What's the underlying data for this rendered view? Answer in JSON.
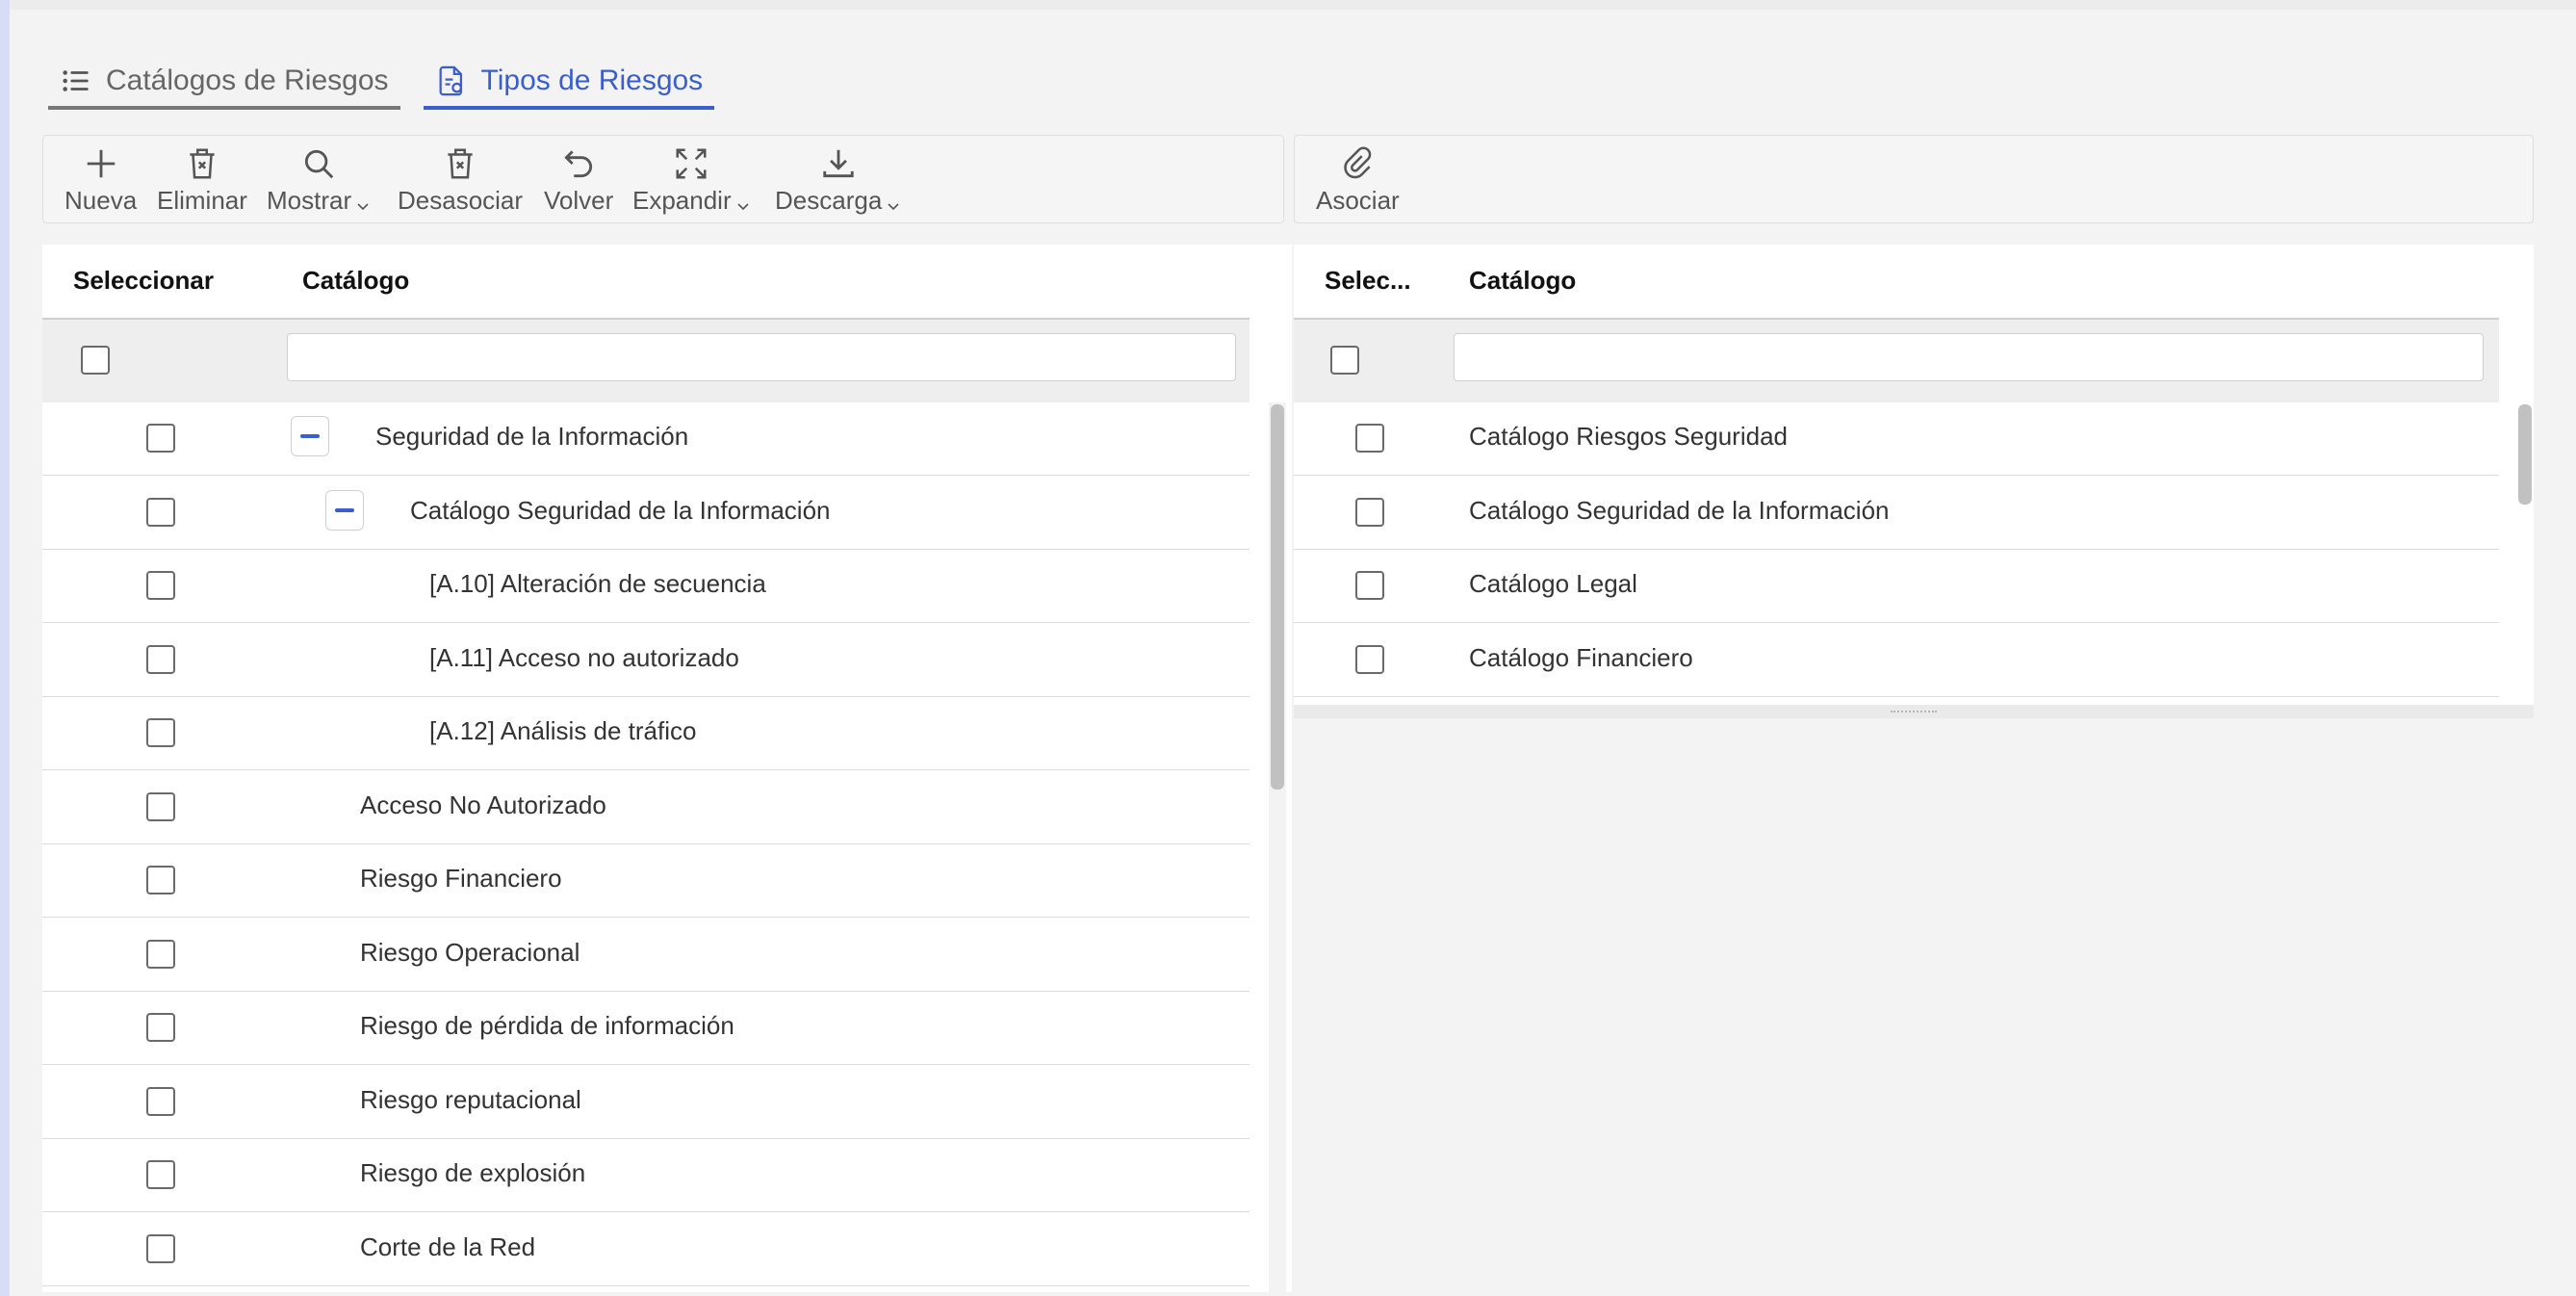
{
  "tabs": [
    {
      "label": "Catálogos de Riesgos",
      "icon": "list-icon",
      "active": false
    },
    {
      "label": "Tipos de Riesgos",
      "icon": "document-settings-icon",
      "active": true
    }
  ],
  "toolbar_left": [
    {
      "label": "Nueva",
      "icon": "plus-icon"
    },
    {
      "label": "Eliminar",
      "icon": "trash-x-icon"
    },
    {
      "label": "Mostrar",
      "icon": "search-icon",
      "dropdown": true
    },
    {
      "label": "Desasociar",
      "icon": "trash-x-icon"
    },
    {
      "label": "Volver",
      "icon": "undo-icon"
    },
    {
      "label": "Expandir",
      "icon": "expand-icon",
      "dropdown": true
    },
    {
      "label": "Descarga",
      "icon": "download-icon",
      "dropdown": true
    }
  ],
  "toolbar_right": [
    {
      "label": "Asociar",
      "icon": "paperclip-icon"
    }
  ],
  "left_table": {
    "headers": {
      "select": "Seleccionar",
      "catalog": "Catálogo"
    },
    "filter_value": "",
    "rows": [
      {
        "label": "Seguridad de la Información",
        "toggle": "collapse"
      },
      {
        "label": "Catálogo Seguridad de la Información",
        "toggle": "collapse"
      },
      {
        "label": "[A.10] Alteración de secuencia"
      },
      {
        "label": "[A.11] Acceso no autorizado"
      },
      {
        "label": "[A.12] Análisis de tráfico"
      },
      {
        "label": "Acceso No Autorizado"
      },
      {
        "label": "Riesgo Financiero"
      },
      {
        "label": "Riesgo Operacional"
      },
      {
        "label": "Riesgo de pérdida de información"
      },
      {
        "label": "Riesgo reputacional"
      },
      {
        "label": "Riesgo de explosión"
      },
      {
        "label": "Corte de la Red"
      }
    ]
  },
  "right_table": {
    "headers": {
      "select": "Selec...",
      "catalog": "Catálogo"
    },
    "filter_value": "",
    "rows": [
      {
        "label": "Catálogo Riesgos Seguridad"
      },
      {
        "label": "Catálogo Seguridad de la Información"
      },
      {
        "label": "Catálogo Legal"
      },
      {
        "label": "Catálogo Financiero"
      }
    ]
  },
  "colors": {
    "accent": "#3a5fcd",
    "header_border": "#cfcfcf",
    "background": "#f3f3f3"
  }
}
